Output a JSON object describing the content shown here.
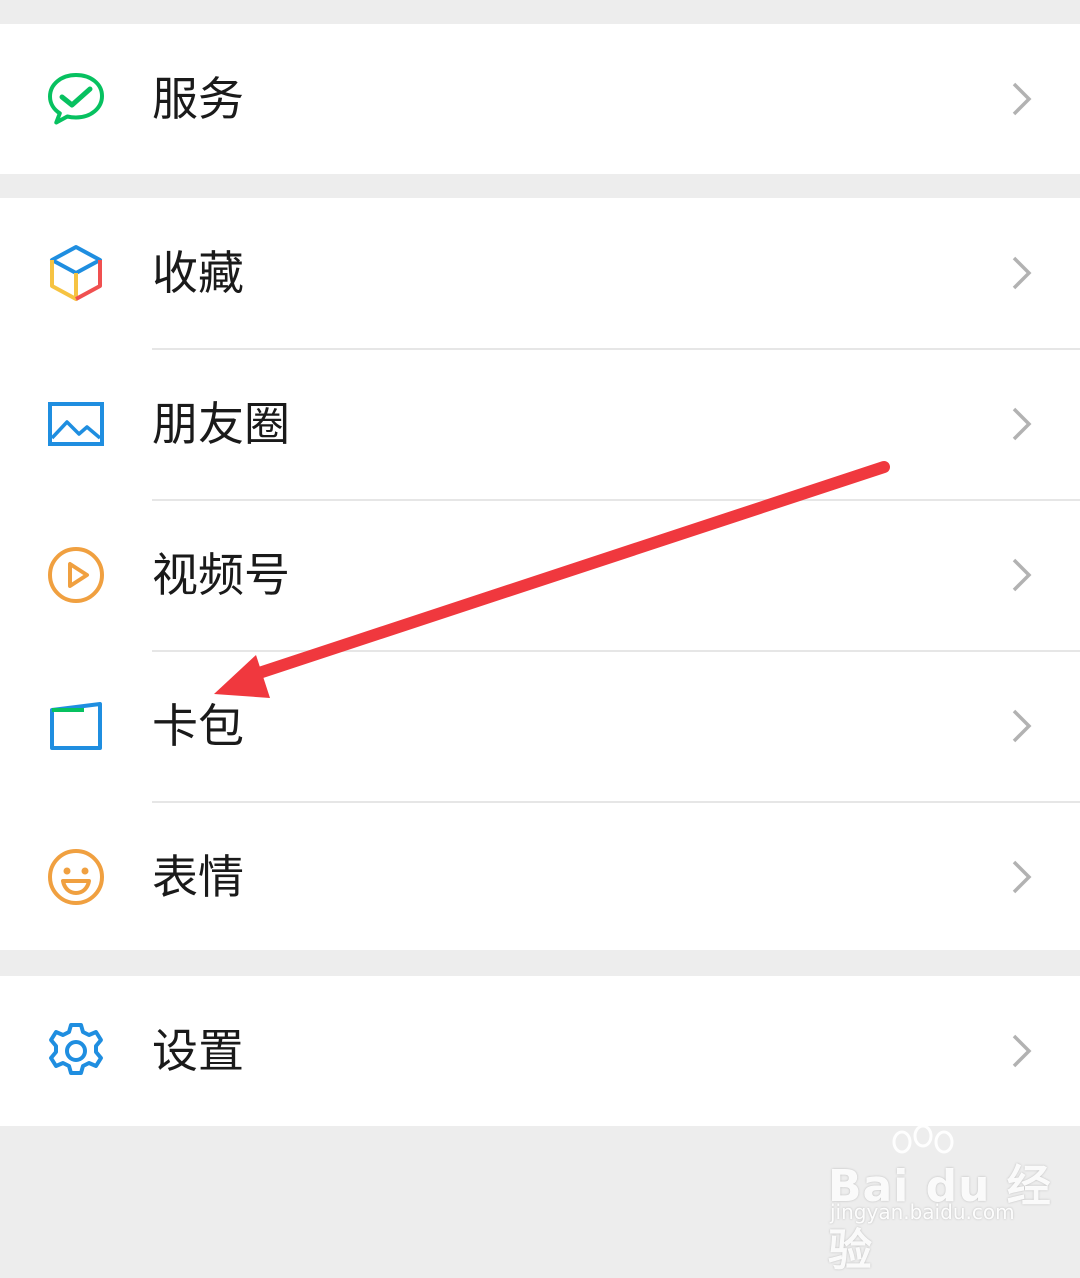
{
  "menu": {
    "items": [
      {
        "label": "服务",
        "icon": "wechat-pay-icon"
      },
      {
        "label": "收藏",
        "icon": "favorites-cube-icon"
      },
      {
        "label": "朋友圈",
        "icon": "moments-image-icon"
      },
      {
        "label": "视频号",
        "icon": "channels-play-icon"
      },
      {
        "label": "卡包",
        "icon": "card-wallet-icon"
      },
      {
        "label": "表情",
        "icon": "smiley-icon"
      },
      {
        "label": "设置",
        "icon": "settings-gear-icon"
      }
    ]
  },
  "annotation": {
    "type": "arrow",
    "color": "#f0383e",
    "points_to": "卡包"
  },
  "watermark": {
    "brand": "Bai du 经验",
    "url": "jingyan.baidu.com"
  },
  "colors": {
    "background": "#ededed",
    "row": "#ffffff",
    "green": "#07c160",
    "blue": "#1f8ee0",
    "orange": "#f0a040",
    "chevron": "#b2b2b2"
  }
}
